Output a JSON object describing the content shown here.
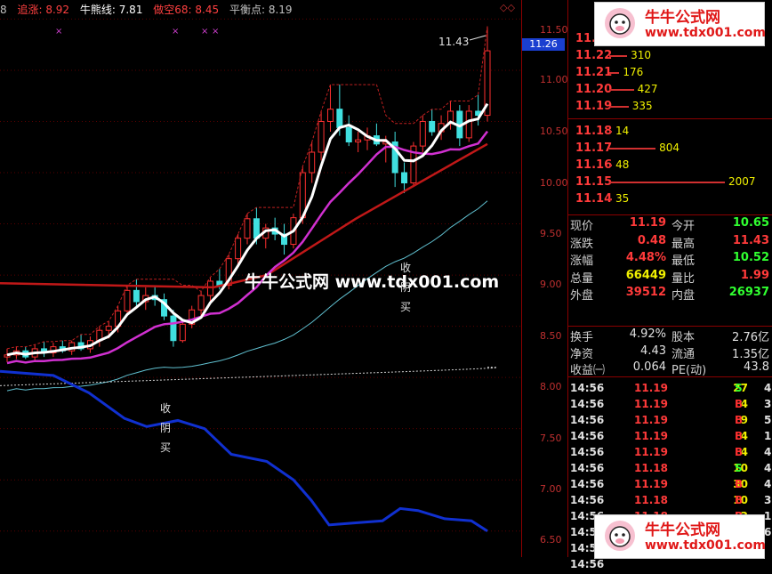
{
  "header": {
    "prefix": "8",
    "items": [
      {
        "label": "追涨: 8.92",
        "color": "#ff4040"
      },
      {
        "label": "牛熊线: 7.81",
        "color": "#ffffff"
      },
      {
        "label": "做空68: 8.45",
        "color": "#ff4040"
      },
      {
        "label": "平衡点: 8.19",
        "color": "#c0c0c0"
      }
    ]
  },
  "chart_text": {
    "high_marker": "11.43",
    "watermark": "牛牛公式网 www.tdx001.com",
    "signal_a": [
      "收",
      "阴",
      "买"
    ],
    "signal_b": [
      "收",
      "阴",
      "买"
    ]
  },
  "axis": {
    "labels": [
      "11.50",
      "11.00",
      "10.50",
      "10.00",
      "9.50",
      "9.00",
      "8.50",
      "8.00",
      "7.50",
      "7.00",
      "6.50"
    ],
    "current_price": "11.26"
  },
  "chart_data": {
    "type": "candlestick",
    "y_range": [
      6.35,
      11.6
    ],
    "candles": [
      [
        8.2,
        8.28,
        8.15,
        8.22
      ],
      [
        8.22,
        8.3,
        8.18,
        8.26
      ],
      [
        8.26,
        8.3,
        8.18,
        8.2
      ],
      [
        8.2,
        8.32,
        8.16,
        8.28
      ],
      [
        8.28,
        8.35,
        8.2,
        8.24
      ],
      [
        8.24,
        8.34,
        8.2,
        8.3
      ],
      [
        8.3,
        8.36,
        8.24,
        8.26
      ],
      [
        8.26,
        8.36,
        8.22,
        8.34
      ],
      [
        8.34,
        8.42,
        8.26,
        8.28
      ],
      [
        8.28,
        8.4,
        8.24,
        8.36
      ],
      [
        8.36,
        8.5,
        8.3,
        8.46
      ],
      [
        8.46,
        8.55,
        8.38,
        8.5
      ],
      [
        8.5,
        8.7,
        8.44,
        8.65
      ],
      [
        8.65,
        8.9,
        8.6,
        8.85
      ],
      [
        8.85,
        8.96,
        8.7,
        8.74
      ],
      [
        8.74,
        8.88,
        8.66,
        8.8
      ],
      [
        8.8,
        8.9,
        8.7,
        8.76
      ],
      [
        8.76,
        8.82,
        8.56,
        8.6
      ],
      [
        8.6,
        8.66,
        8.3,
        8.36
      ],
      [
        8.36,
        8.56,
        8.34,
        8.52
      ],
      [
        8.52,
        8.7,
        8.48,
        8.66
      ],
      [
        8.66,
        8.84,
        8.6,
        8.8
      ],
      [
        8.8,
        8.98,
        8.74,
        8.94
      ],
      [
        8.94,
        9.06,
        8.86,
        8.9
      ],
      [
        8.9,
        9.2,
        8.86,
        9.16
      ],
      [
        9.16,
        9.4,
        9.1,
        9.36
      ],
      [
        9.36,
        9.6,
        9.3,
        9.55
      ],
      [
        9.55,
        9.66,
        9.3,
        9.36
      ],
      [
        9.36,
        9.5,
        9.26,
        9.46
      ],
      [
        9.46,
        9.56,
        9.34,
        9.4
      ],
      [
        9.4,
        9.5,
        9.2,
        9.3
      ],
      [
        9.3,
        9.6,
        9.26,
        9.56
      ],
      [
        9.56,
        10.06,
        9.5,
        10.0
      ],
      [
        10.0,
        10.3,
        9.9,
        10.2
      ],
      [
        10.2,
        10.6,
        10.12,
        10.5
      ],
      [
        10.5,
        10.86,
        10.4,
        10.62
      ],
      [
        10.62,
        10.86,
        10.36,
        10.44
      ],
      [
        10.44,
        10.56,
        10.26,
        10.3
      ],
      [
        10.3,
        10.4,
        10.2,
        10.32
      ],
      [
        10.32,
        10.44,
        10.22,
        10.36
      ],
      [
        10.36,
        10.48,
        10.26,
        10.28
      ],
      [
        10.28,
        10.36,
        10.1,
        10.3
      ],
      [
        10.3,
        10.4,
        9.86,
        10.0
      ],
      [
        10.0,
        10.1,
        9.8,
        9.9
      ],
      [
        9.9,
        10.3,
        9.86,
        10.26
      ],
      [
        10.26,
        10.56,
        10.2,
        10.5
      ],
      [
        10.5,
        10.62,
        10.36,
        10.4
      ],
      [
        10.4,
        10.56,
        10.32,
        10.48
      ],
      [
        10.48,
        10.7,
        10.42,
        10.6
      ],
      [
        10.6,
        10.66,
        10.26,
        10.34
      ],
      [
        10.34,
        10.66,
        10.3,
        10.6
      ],
      [
        10.6,
        10.76,
        10.46,
        10.56
      ],
      [
        10.56,
        11.43,
        10.5,
        11.19
      ]
    ]
  },
  "order_book": {
    "asks": [
      {
        "price": "11.",
        "vol": ""
      },
      {
        "price": "11.22",
        "vol": "310"
      },
      {
        "price": "11.21",
        "vol": "176"
      },
      {
        "price": "11.20",
        "vol": "427"
      },
      {
        "price": "11.19",
        "vol": "335"
      }
    ],
    "bids": [
      {
        "price": "11.18",
        "vol": "14"
      },
      {
        "price": "11.17",
        "vol": "804"
      },
      {
        "price": "11.16",
        "vol": "48"
      },
      {
        "price": "11.15",
        "vol": "2007"
      },
      {
        "price": "11.14",
        "vol": "35"
      }
    ]
  },
  "quote": [
    {
      "l1": "现价",
      "v1": "11.19",
      "c1": "#ff3a3a",
      "l2": "今开",
      "v2": "10.65",
      "c2": "#30ff30"
    },
    {
      "l1": "涨跌",
      "v1": "0.48",
      "c1": "#ff3a3a",
      "l2": "最高",
      "v2": "11.43",
      "c2": "#ff3a3a"
    },
    {
      "l1": "涨幅",
      "v1": "4.48%",
      "c1": "#ff3a3a",
      "l2": "最低",
      "v2": "10.52",
      "c2": "#30ff30"
    },
    {
      "l1": "总量",
      "v1": "66449",
      "c1": "#f0f000",
      "l2": "量比",
      "v2": "1.99",
      "c2": "#ff3a3a"
    },
    {
      "l1": "外盘",
      "v1": "39512",
      "c1": "#ff3a3a",
      "l2": "内盘",
      "v2": "26937",
      "c2": "#30ff30"
    }
  ],
  "fundamentals": [
    {
      "l1": "换手",
      "v1": "4.92%",
      "l2": "股本",
      "v2": "2.76亿"
    },
    {
      "l1": "净资",
      "v1": "4.43",
      "l2": "流通",
      "v2": "1.35亿"
    },
    {
      "l1": "收益㈠",
      "v1": "0.064",
      "l2": "PE(动)",
      "v2": "43.8"
    }
  ],
  "ticks": [
    {
      "time": "14:56",
      "price": "11.19",
      "vol": "27",
      "side": "S",
      "n": "4"
    },
    {
      "time": "14:56",
      "price": "11.19",
      "vol": "4",
      "side": "B",
      "n": "3"
    },
    {
      "time": "14:56",
      "price": "11.19",
      "vol": "9",
      "side": "B",
      "n": "5"
    },
    {
      "time": "14:56",
      "price": "11.19",
      "vol": "4",
      "side": "B",
      "n": "1"
    },
    {
      "time": "14:56",
      "price": "11.19",
      "vol": "4",
      "side": "B",
      "n": "4"
    },
    {
      "time": "14:56",
      "price": "11.18",
      "vol": "10",
      "side": "S",
      "n": "4"
    },
    {
      "time": "14:56",
      "price": "11.19",
      "vol": "30",
      "side": "B",
      "n": "4"
    },
    {
      "time": "14:56",
      "price": "11.18",
      "vol": "10",
      "side": "B",
      "n": "3"
    },
    {
      "time": "14:56",
      "price": "11.18",
      "vol": "2",
      "side": "B",
      "n": "1"
    },
    {
      "time": "14:56",
      "price": "11.18",
      "vol": "18",
      "side": "B",
      "n": "6"
    },
    {
      "time": "14:56",
      "price": "11.18",
      "vol": "",
      "side": "",
      "n": ""
    },
    {
      "time": "14:56",
      "price": "",
      "vol": "",
      "side": "",
      "n": ""
    }
  ],
  "logo": {
    "title": "牛牛公式网",
    "site": "www.tdx001.com"
  },
  "colors": {
    "up": "#ff3030",
    "down": "#40e0e0",
    "ask": "#ff3a3a",
    "vol": "#f0f000",
    "buy": "#ff3030",
    "sell": "#30ff30"
  }
}
